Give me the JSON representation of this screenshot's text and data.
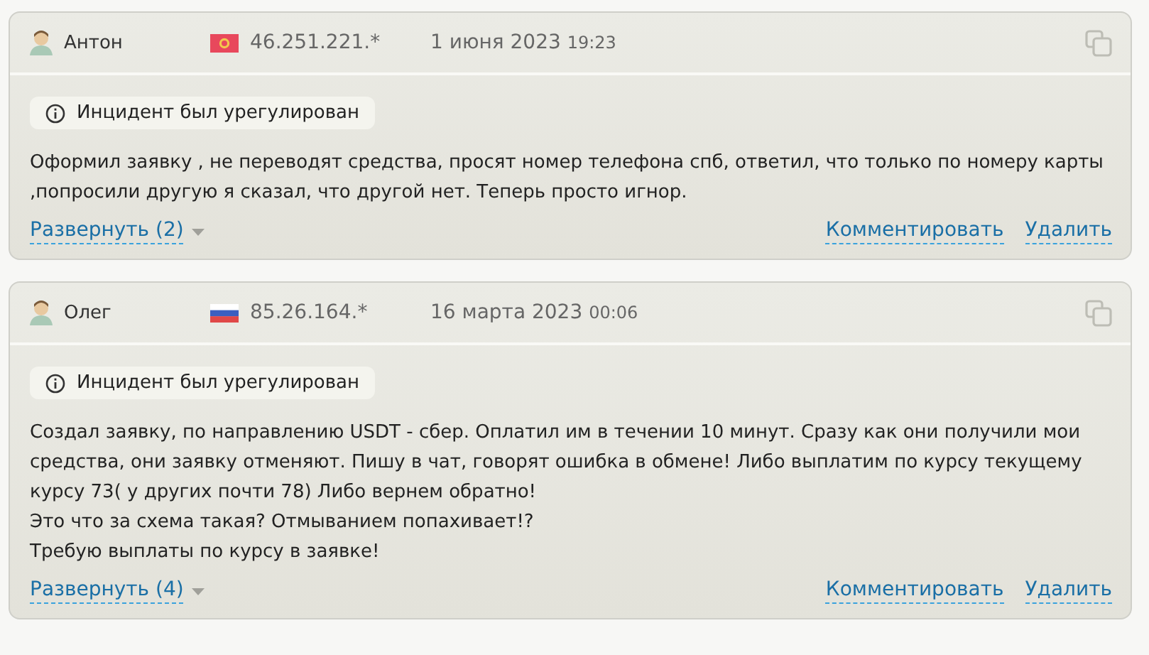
{
  "reviews": [
    {
      "author": "Антон",
      "kind": "kg",
      "ip": "46.251.221.*",
      "date": "1 июня 2023",
      "time": "19:23",
      "status": "Инцидент был урегулирован",
      "text": "Оформил заявку , не переводят средства, просят номер телефона спб, ответил, что только по номеру карты ,попросили другую я сказал, что другой нет. Теперь просто игнор.",
      "expand": "Развернуть (2)",
      "actions": [
        "Комментировать",
        "Удалить"
      ]
    },
    {
      "author": "Олег",
      "kind": "ru",
      "ip": "85.26.164.*",
      "date": "16 марта 2023",
      "time": "00:06",
      "status": "Инцидент был урегулирован",
      "text": "Создал заявку, по направлению USDT - сбер. Оплатил им в течении 10 минут. Сразу как они получили мои средства, они заявку отменяют. Пишу в чат, говорят ошибка в обмене! Либо выплатим по курсу текущему курсу 73( у других почти 78) Либо вернем обратно!\nЭто что за схема такая? Отмыванием попахивает!?\nТребую выплаты по курсу в заявке!",
      "expand": "Развернуть (4)",
      "actions": [
        "Комментировать",
        "Удалить"
      ]
    }
  ]
}
